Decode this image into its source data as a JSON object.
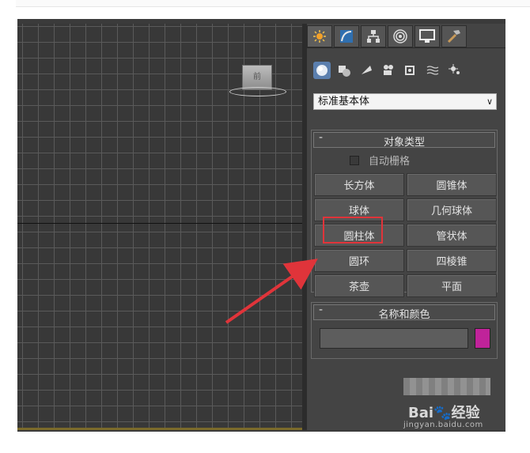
{
  "viewport": {
    "viewcube_label": "前"
  },
  "tabs": [
    {
      "icon": "create-sun-icon",
      "active": true
    },
    {
      "icon": "modify-curve-icon",
      "active": false
    },
    {
      "icon": "hierarchy-icon",
      "active": false
    },
    {
      "icon": "motion-icon",
      "active": false
    },
    {
      "icon": "display-monitor-icon",
      "active": false
    },
    {
      "icon": "utilities-hammer-icon",
      "active": false
    }
  ],
  "subcategories": [
    {
      "icon": "geometry-sphere-icon",
      "active": true
    },
    {
      "icon": "shapes-icon",
      "active": false
    },
    {
      "icon": "lights-icon",
      "active": false
    },
    {
      "icon": "cameras-icon",
      "active": false
    },
    {
      "icon": "helpers-icon",
      "active": false
    },
    {
      "icon": "spacewarps-icon",
      "active": false
    },
    {
      "icon": "systems-icon",
      "active": false
    }
  ],
  "dropdown": {
    "value": "标准基本体"
  },
  "object_type": {
    "title": "对象类型",
    "collapse_symbol": "-",
    "autogrid_label": "自动栅格",
    "autogrid_checked": false,
    "buttons": [
      "长方体",
      "圆锥体",
      "球体",
      "几何球体",
      "圆柱体",
      "管状体",
      "圆环",
      "四棱锥",
      "茶壶",
      "平面"
    ],
    "highlighted": "圆柱体"
  },
  "name_color": {
    "title": "名称和颜色",
    "collapse_symbol": "-",
    "name_value": "",
    "color": "#c0239a"
  },
  "colors": {
    "highlight": "#e0343a",
    "arrow": "#e0343a"
  },
  "watermark": {
    "brand": "Bai🐾经验",
    "url": "jingyan.baidu.com"
  }
}
